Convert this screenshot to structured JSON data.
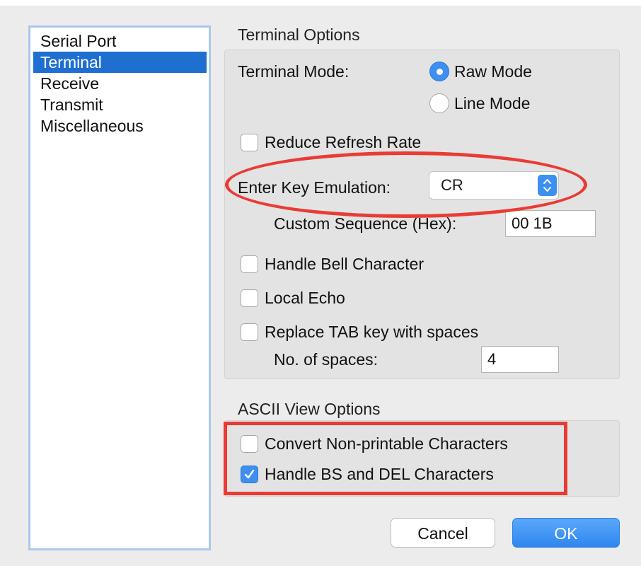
{
  "sidebar": {
    "items": [
      {
        "label": "Serial Port",
        "selected": false
      },
      {
        "label": "Terminal",
        "selected": true
      },
      {
        "label": "Receive",
        "selected": false
      },
      {
        "label": "Transmit",
        "selected": false
      },
      {
        "label": "Miscellaneous",
        "selected": false
      }
    ]
  },
  "terminal_options": {
    "title": "Terminal Options",
    "terminal_mode_label": "Terminal Mode:",
    "raw_mode_label": "Raw Mode",
    "line_mode_label": "Line Mode",
    "selected_mode": "Raw Mode",
    "reduce_refresh_label": "Reduce Refresh Rate",
    "reduce_refresh_checked": false,
    "enter_key_label": "Enter Key Emulation:",
    "enter_key_value": "CR",
    "custom_sequence_label": "Custom Sequence (Hex):",
    "custom_sequence_value": "00 1B",
    "handle_bell_label": "Handle Bell Character",
    "handle_bell_checked": false,
    "local_echo_label": "Local Echo",
    "local_echo_checked": false,
    "replace_tab_label": "Replace TAB key with spaces",
    "replace_tab_checked": false,
    "num_spaces_label": "No. of spaces:",
    "num_spaces_value": "4"
  },
  "ascii_options": {
    "title": "ASCII View Options",
    "convert_label": "Convert Non-printable Characters",
    "convert_checked": false,
    "handle_bs_label": "Handle BS and DEL Characters",
    "handle_bs_checked": true
  },
  "buttons": {
    "cancel_label": "Cancel",
    "ok_label": "OK"
  },
  "colors": {
    "accent": "#3d8ff0",
    "selection": "#1f6fd1",
    "annotation": "#ea3b34"
  }
}
